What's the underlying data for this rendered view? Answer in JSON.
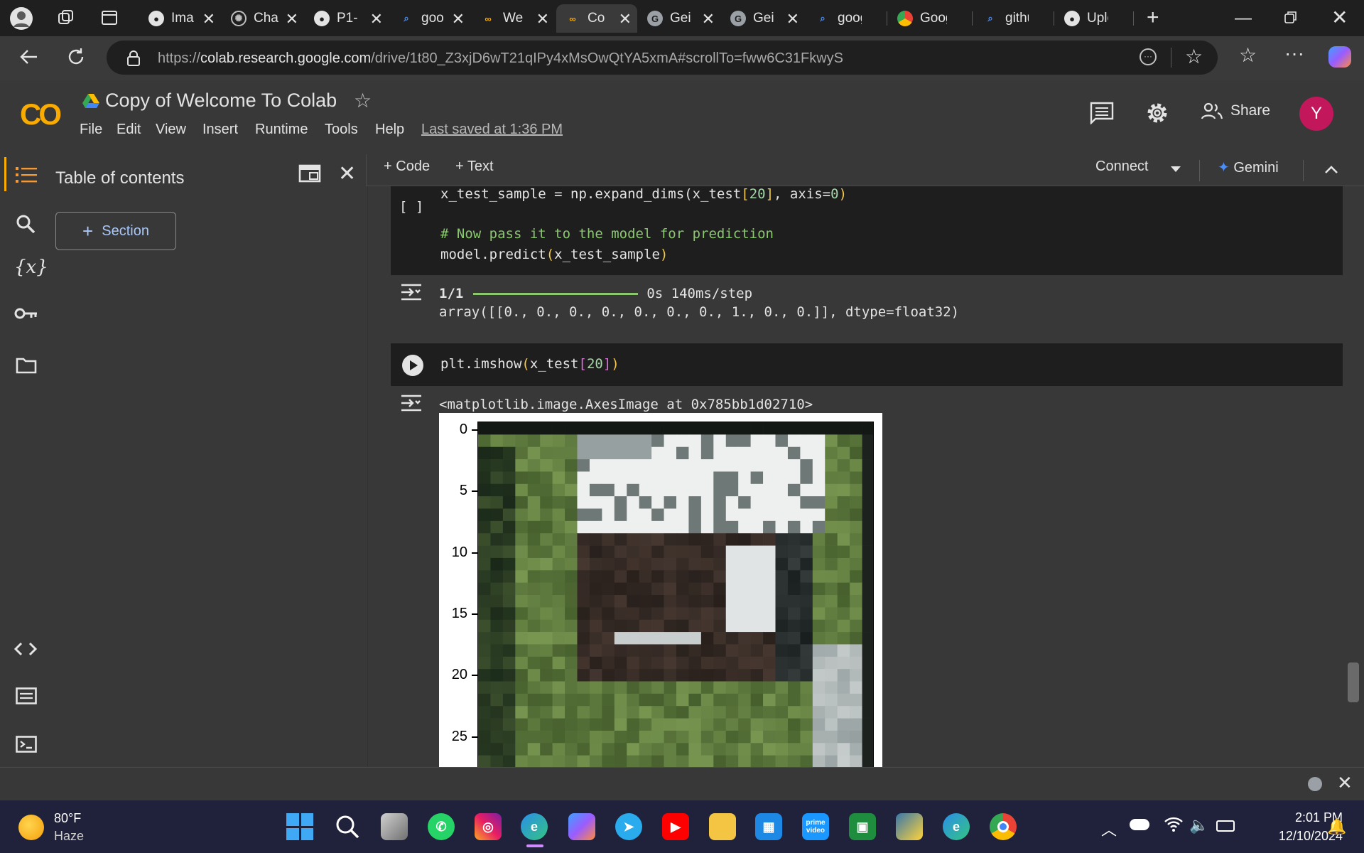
{
  "browser": {
    "tabs": [
      {
        "label": "Ima",
        "icon": "github-icon"
      },
      {
        "label": "Cha",
        "icon": "openai-icon"
      },
      {
        "label": "P1-",
        "icon": "github-icon"
      },
      {
        "label": "goo",
        "icon": "search-icon"
      },
      {
        "label": "We",
        "icon": "colab-icon"
      },
      {
        "label": "Co",
        "icon": "colab-icon",
        "active": true
      },
      {
        "label": "Gei",
        "icon": "google-icon"
      },
      {
        "label": "Gei",
        "icon": "google-icon"
      },
      {
        "label": "google",
        "icon": "search-icon"
      },
      {
        "label": "Google",
        "icon": "chrome-icon"
      },
      {
        "label": "github",
        "icon": "search-icon"
      },
      {
        "label": "Upload",
        "icon": "github-icon"
      }
    ],
    "url_prefix": "https://",
    "url_domain": "colab.research.google.com",
    "url_path": "/drive/1t80_Z3xjD6wT21qIPy4xMsOwQtYA5xmA#scrollTo=fww6C31FkwyS"
  },
  "colab": {
    "logo": "CO",
    "title": "Copy of Welcome To Colab",
    "menu": [
      "File",
      "Edit",
      "View",
      "Insert",
      "Runtime",
      "Tools",
      "Help"
    ],
    "last_saved": "Last saved at 1:36 PM",
    "share_label": "Share",
    "avatar_letter": "Y",
    "accent": "#f9ab00",
    "avatar_color": "#c2185b"
  },
  "toolbar": {
    "add_code": "Code",
    "add_text": "Text",
    "connect": "Connect",
    "gemini": "Gemini"
  },
  "toc": {
    "title": "Table of contents",
    "section_button": "Section"
  },
  "cells": {
    "cell1": {
      "bracket": "[ ]",
      "line1_pre": "x_test_sample = np.expand_dims(x_test",
      "line1_idx": "20",
      "line1_post": ", axis=",
      "line1_zero": "0",
      "comment": "# Now pass it to the model for prediction",
      "line3_pre": "model.predict",
      "line3_arg": "x_test_sample",
      "out_step": "1/1",
      "out_time": "0s 140ms/step",
      "out_array": "array([[0., 0., 0., 0., 0., 0., 0., 1., 0., 0.]], dtype=float32)"
    },
    "cell2": {
      "code_pre": "plt.imshow",
      "code_arg": "x_test",
      "code_idx": "20",
      "output_text": "<matplotlib.image.AxesImage at 0x785bb1d02710>",
      "yticks": [
        "0",
        "5",
        "10",
        "15",
        "20",
        "25"
      ]
    }
  },
  "taskbar": {
    "weather_temp": "80°F",
    "weather_desc": "Haze",
    "time": "2:01 PM",
    "date": "12/10/2024"
  }
}
